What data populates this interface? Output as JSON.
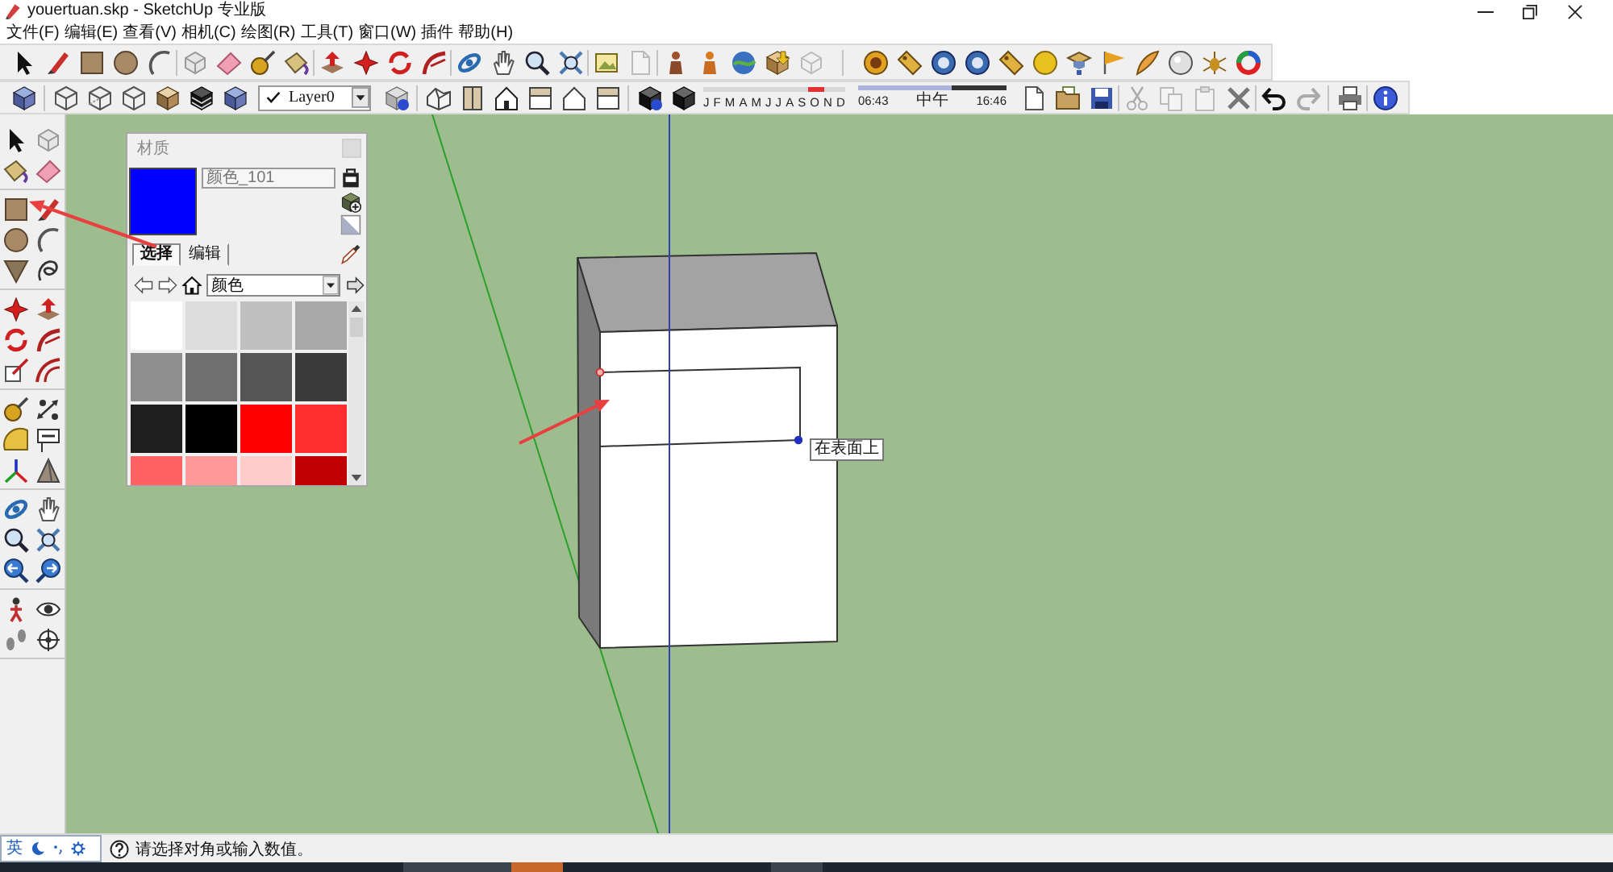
{
  "window": {
    "title": "youertuan.skp - SketchUp 专业版"
  },
  "menu": [
    "文件(F)",
    "编辑(E)",
    "查看(V)",
    "相机(C)",
    "绘图(R)",
    "工具(T)",
    "窗口(W)",
    "插件",
    "帮助(H)"
  ],
  "toolbar": {
    "layer": {
      "name": "Layer0",
      "visible": true
    },
    "shadow_months": {
      "months": [
        "J",
        "F",
        "M",
        "A",
        "M",
        "J",
        "J",
        "A",
        "S",
        "O",
        "N",
        "D"
      ],
      "level": 0.79
    },
    "shadow_time": {
      "start": "06:43",
      "middle": "中午",
      "end": "16:46",
      "level": 0.65
    }
  },
  "materials_panel": {
    "title": "材质",
    "current": {
      "name": "颜色_101",
      "color": "#0000ff"
    },
    "tabs": [
      {
        "label": "选择",
        "selected": true
      },
      {
        "label": "编辑",
        "selected": false
      }
    ],
    "collection": "颜色",
    "swatches": [
      {
        "color": "#ffffff",
        "selected": false
      },
      {
        "color": "#dcdcdc",
        "selected": false
      },
      {
        "color": "#c0c0c0",
        "selected": false
      },
      {
        "color": "#a8a8a8",
        "selected": false
      },
      {
        "color": "#8e8e8e",
        "selected": false
      },
      {
        "color": "#6f6f6f",
        "selected": false
      },
      {
        "color": "#555555",
        "selected": false
      },
      {
        "color": "#3a3a3a",
        "selected": false
      },
      {
        "color": "#1e1e1e",
        "selected": false
      },
      {
        "color": "#000000",
        "selected": false
      },
      {
        "color": "#ff0000",
        "selected": false
      },
      {
        "color": "#ff2d2d",
        "selected": false
      },
      {
        "color": "#ff6262",
        "selected": false
      },
      {
        "color": "#ff9999",
        "selected": false
      },
      {
        "color": "#ffcccc",
        "selected": false
      },
      {
        "color": "#c00000",
        "selected": false
      }
    ]
  },
  "viewport": {
    "tooltip": "在表面上"
  },
  "status_bar": {
    "input_language": "英",
    "message": "请选择对角或输入数值。"
  }
}
